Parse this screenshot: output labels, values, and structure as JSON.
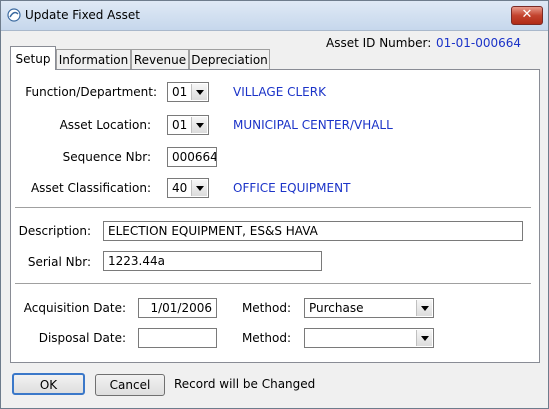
{
  "window": {
    "title": "Update Fixed Asset",
    "close_label": "✕"
  },
  "asset_id": {
    "label": "Asset ID Number:",
    "value": "01-01-000664"
  },
  "tabs": [
    {
      "label": "Setup",
      "active": true
    },
    {
      "label": "Information",
      "active": false
    },
    {
      "label": "Revenue",
      "active": false
    },
    {
      "label": "Depreciation",
      "active": false
    }
  ],
  "setup": {
    "function_department": {
      "label": "Function/Department:",
      "value": "01",
      "description": "VILLAGE CLERK"
    },
    "asset_location": {
      "label": "Asset Location:",
      "value": "01",
      "description": "MUNICIPAL CENTER/VHALL"
    },
    "sequence_nbr": {
      "label": "Sequence Nbr:",
      "value": "000664"
    },
    "asset_classification": {
      "label": "Asset Classification:",
      "value": "40",
      "description": "OFFICE EQUIPMENT"
    },
    "description": {
      "label": "Description:",
      "value": "ELECTION EQUIPMENT, ES&S HAVA"
    },
    "serial_nbr": {
      "label": "Serial Nbr:",
      "value": "1223.44a"
    },
    "acquisition_date": {
      "label": "Acquisition Date:",
      "value": "1/01/2006"
    },
    "acquisition_method": {
      "label": "Method:",
      "value": "Purchase"
    },
    "disposal_date": {
      "label": "Disposal Date:",
      "value": ""
    },
    "disposal_method": {
      "label": "Method:",
      "value": ""
    }
  },
  "footer": {
    "ok_label": "OK",
    "cancel_label": "Cancel",
    "status": "Record will be Changed"
  }
}
